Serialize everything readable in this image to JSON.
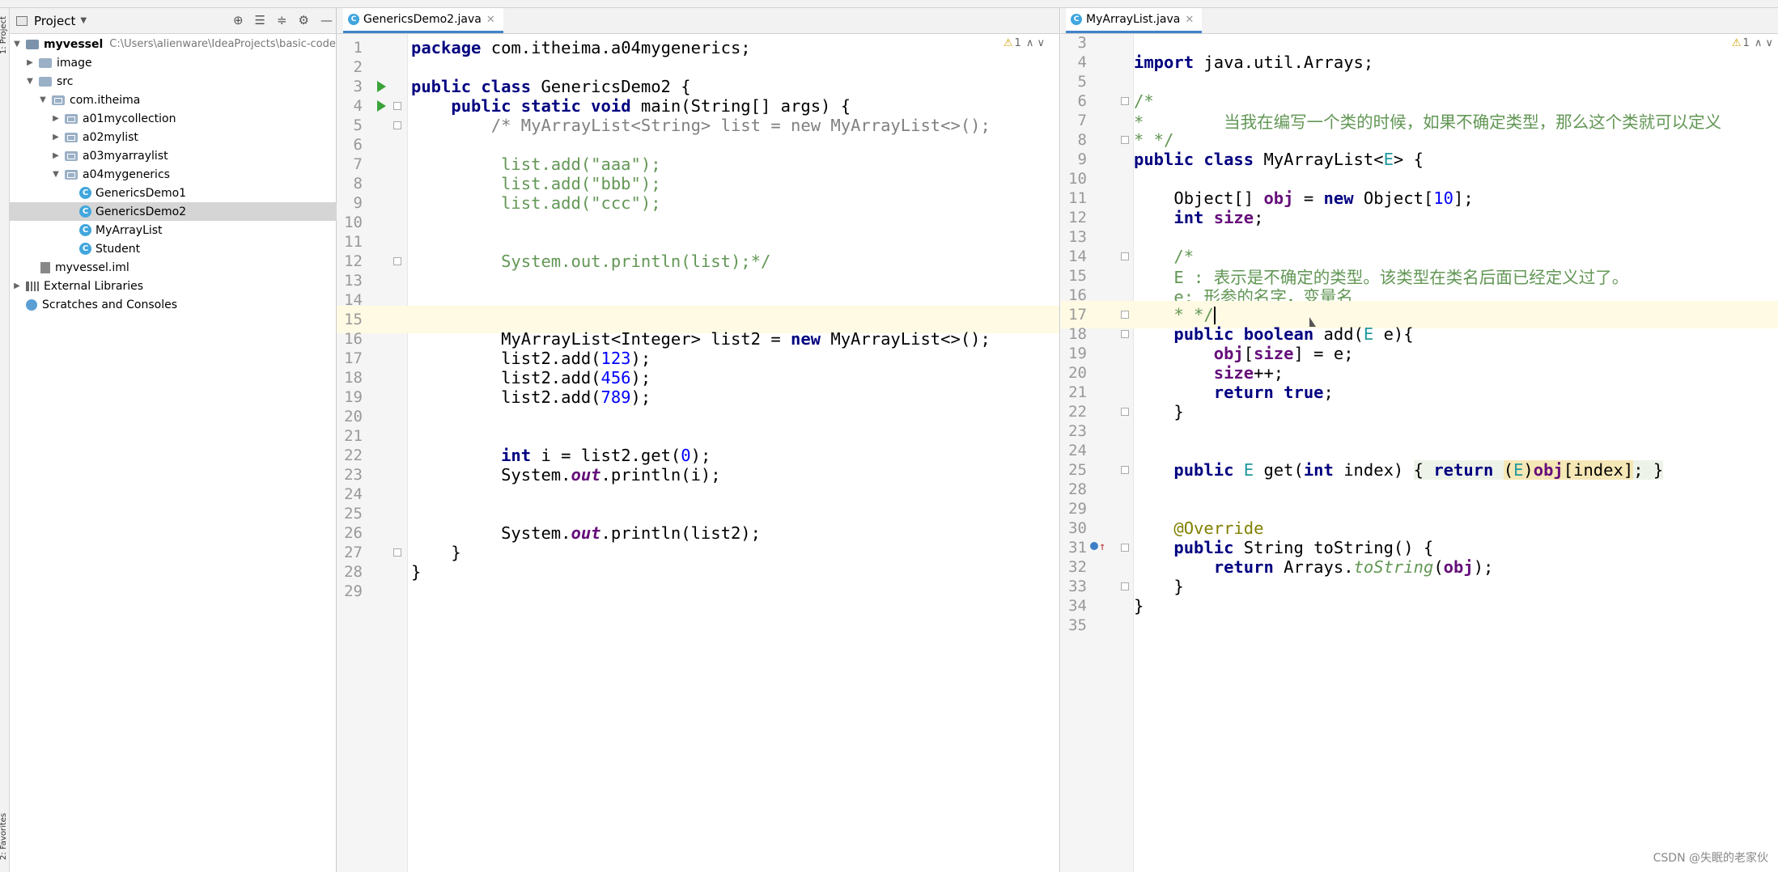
{
  "sidebar_stripe": {
    "top_label": "1: Project",
    "bottom_label": "2: Favorites"
  },
  "project_panel": {
    "title": "Project",
    "tree": [
      {
        "label": "myvessel",
        "hint": "C:\\Users\\alienware\\IdeaProjects\\basic-code",
        "kind": "module",
        "bold": true
      },
      {
        "label": "image",
        "kind": "folder"
      },
      {
        "label": "src",
        "kind": "folder"
      },
      {
        "label": "com.itheima",
        "kind": "package"
      },
      {
        "label": "a01mycollection",
        "kind": "package"
      },
      {
        "label": "a02mylist",
        "kind": "package"
      },
      {
        "label": "a03myarraylist",
        "kind": "package"
      },
      {
        "label": "a04mygenerics",
        "kind": "package"
      },
      {
        "label": "GenericsDemo1",
        "kind": "class"
      },
      {
        "label": "GenericsDemo2",
        "kind": "class",
        "selected": true
      },
      {
        "label": "MyArrayList",
        "kind": "class"
      },
      {
        "label": "Student",
        "kind": "class"
      },
      {
        "label": "myvessel.iml",
        "kind": "iml"
      },
      {
        "label": "External Libraries",
        "kind": "lib"
      },
      {
        "label": "Scratches and Consoles",
        "kind": "scratch"
      }
    ]
  },
  "left_editor": {
    "tab_label": "GenericsDemo2.java",
    "warning_count": "1",
    "current_line": "15"
  },
  "right_editor": {
    "tab_label": "MyArrayList.java",
    "warning_count": "1",
    "current_line": "17"
  },
  "watermark": "CSDN @失眠的老家伙"
}
